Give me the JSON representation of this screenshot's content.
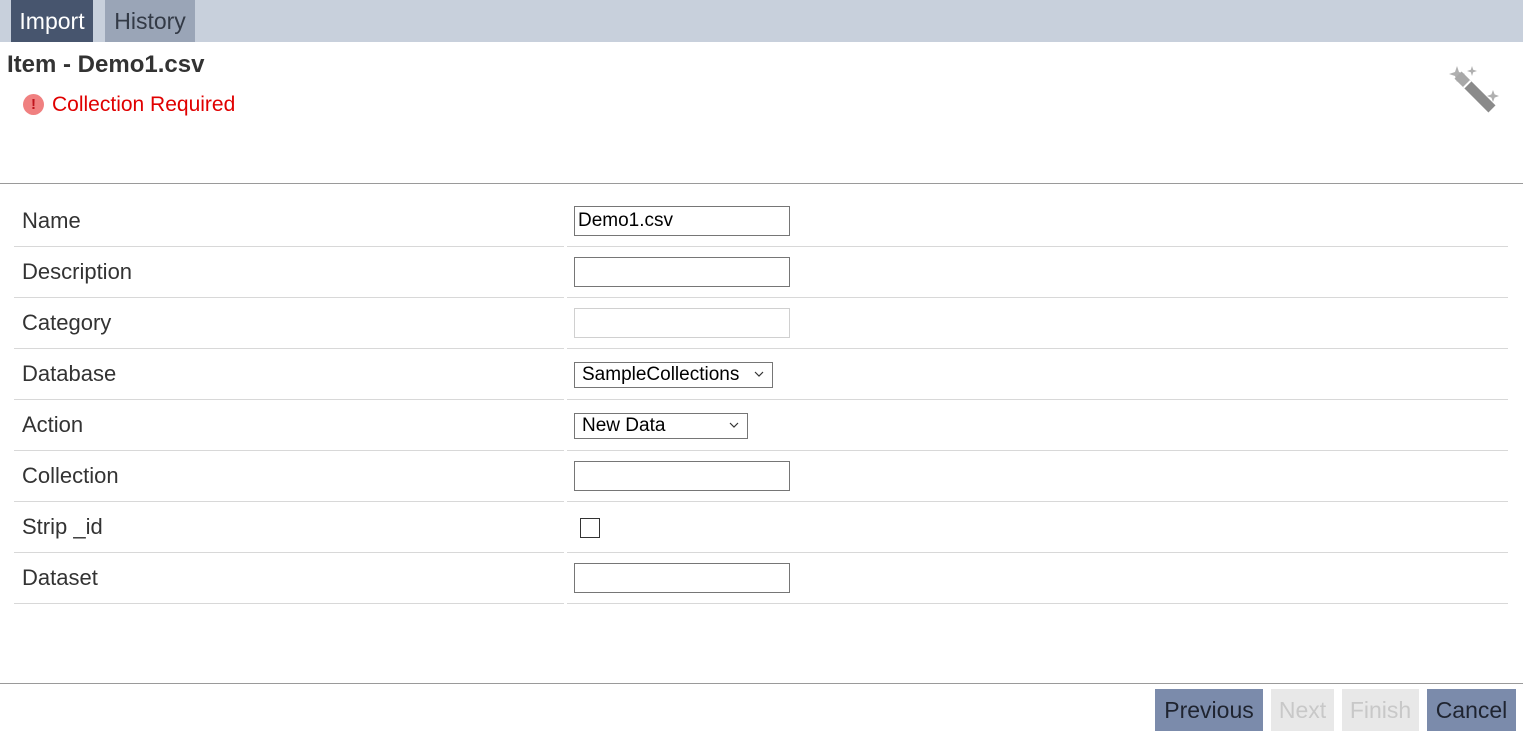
{
  "tabs": [
    {
      "label": "Import",
      "active": true
    },
    {
      "label": "History",
      "active": false
    }
  ],
  "title": "Item - Demo1.csv",
  "error": {
    "icon": "exclamation-circle-icon",
    "symbol": "!",
    "message": "Collection Required"
  },
  "toolbar": {
    "wand_icon": "magic-wand-icon"
  },
  "form": {
    "rows": [
      {
        "label": "Name",
        "type": "text",
        "value": "Demo1.csv",
        "placeholder": ""
      },
      {
        "label": "Description",
        "type": "text",
        "value": "",
        "placeholder": ""
      },
      {
        "label": "Category",
        "type": "text",
        "value": "",
        "placeholder": "",
        "disabled": true
      },
      {
        "label": "Database",
        "type": "select",
        "value": "SampleCollections"
      },
      {
        "label": "Action",
        "type": "select",
        "value": "New Data"
      },
      {
        "label": "Collection",
        "type": "text",
        "value": "",
        "placeholder": ""
      },
      {
        "label": "Strip _id",
        "type": "checkbox",
        "checked": false
      },
      {
        "label": "Dataset",
        "type": "text",
        "value": "",
        "placeholder": ""
      }
    ]
  },
  "footer": {
    "previous_label": "Previous",
    "next_label": "Next",
    "finish_label": "Finish",
    "cancel_label": "Cancel"
  },
  "colors": {
    "tabbar_bg": "#c8d0dc",
    "active_tab": "#47556e",
    "inactive_tab": "#9aa5b7",
    "error_text": "#e00000",
    "button_active": "#7b8bab",
    "button_disabled": "#e8e8e8"
  }
}
